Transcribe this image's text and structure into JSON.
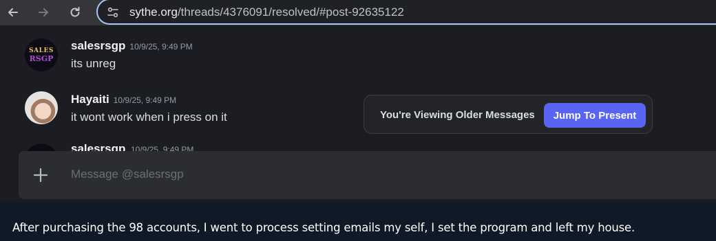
{
  "browser": {
    "url_host": "sythe.org",
    "url_path": "/threads/4376091/resolved/#post-92635122"
  },
  "discord": {
    "messages": [
      {
        "author": "salesrsgp",
        "time": "10/9/25, 9:49 PM",
        "text": "its unreg",
        "avatar_text_1": "SALES",
        "avatar_text_2": "RSGP"
      },
      {
        "author": "Hayaiti",
        "time": "10/9/25, 9:49 PM",
        "text": "it wont work when i press on it"
      },
      {
        "author": "salesrsgp",
        "time": "10/9/25, 9:49 PM"
      }
    ],
    "older_notice": "You're Viewing Older Messages",
    "jump_label": "Jump To Present",
    "composer_placeholder": "Message @salesrsgp"
  },
  "post": {
    "text": "After purchasing the 98 accounts, I went to process setting emails my self, I set the program and left my house."
  },
  "colors": {
    "accent": "#5865f2",
    "omnibox_border": "#a8c7fa"
  }
}
